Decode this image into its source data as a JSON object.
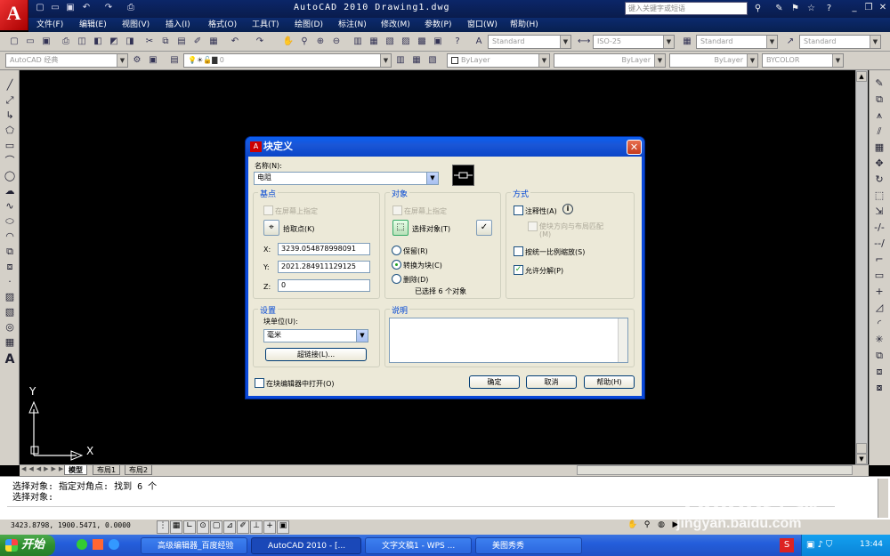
{
  "app": {
    "title": "AutoCAD 2010  Drawing1.dwg",
    "search_placeholder": "键入关键字或短语",
    "logo": "A"
  },
  "menu": [
    "文件(F)",
    "编辑(E)",
    "视图(V)",
    "插入(I)",
    "格式(O)",
    "工具(T)",
    "绘图(D)",
    "标注(N)",
    "修改(M)",
    "参数(P)",
    "窗口(W)",
    "帮助(H)"
  ],
  "toolbar": {
    "text_style": "Standard",
    "dim_style": "ISO-25",
    "table_style": "Standard",
    "mleader_style": "Standard",
    "workspace": "AutoCAD 经典",
    "layer": "0",
    "color": "ByLayer",
    "linetype": "ByLayer",
    "lineweight": "ByLayer",
    "plotstyle": "BYCOLOR"
  },
  "ucs": {
    "x": "X",
    "y": "Y"
  },
  "layout_tabs": [
    "模型",
    "布局1",
    "布局2"
  ],
  "command_lines": [
    "选择对象: 指定对角点: 找到 6 个",
    "选择对象:"
  ],
  "status": {
    "coords": "3423.8798, 1900.5471, 0.0000"
  },
  "taskbar": {
    "start": "开始",
    "tasks": [
      "高级编辑器_百度经验",
      "AutoCAD 2010 - [...",
      "文字文稿1 - WPS ...",
      "美图秀秀"
    ],
    "clock": "13:44"
  },
  "watermark": {
    "line1": "Baidu经验",
    "line2": "jingyan.baidu.com"
  },
  "dialog": {
    "title": "块定义",
    "name_label": "名称(N):",
    "name_value": "电阻",
    "base": {
      "title": "基点",
      "onscreen": "在屏幕上指定",
      "pick_point": "拾取点(K)",
      "x_label": "X:",
      "x_value": "3239.054878998091",
      "y_label": "Y:",
      "y_value": "2021.284911129125",
      "z_label": "Z:",
      "z_value": "0"
    },
    "objects": {
      "title": "对象",
      "onscreen": "在屏幕上指定",
      "select": "选择对象(T)",
      "retain": "保留(R)",
      "convert": "转换为块(C)",
      "delete": "删除(D)",
      "selected": "已选择 6 个对象"
    },
    "behavior": {
      "title": "方式",
      "annotative": "注释性(A)",
      "match_orient": "使块方向与布局匹配(M)",
      "scale_uniform": "按统一比例缩放(S)",
      "allow_explode": "允许分解(P)"
    },
    "settings": {
      "title": "设置",
      "unit_label": "块单位(U):",
      "unit_value": "毫米",
      "hyperlink": "超链接(L)..."
    },
    "description": {
      "title": "说明"
    },
    "open_editor": "在块编辑器中打开(O)",
    "ok": "确定",
    "cancel": "取消",
    "help": "帮助(H)"
  }
}
